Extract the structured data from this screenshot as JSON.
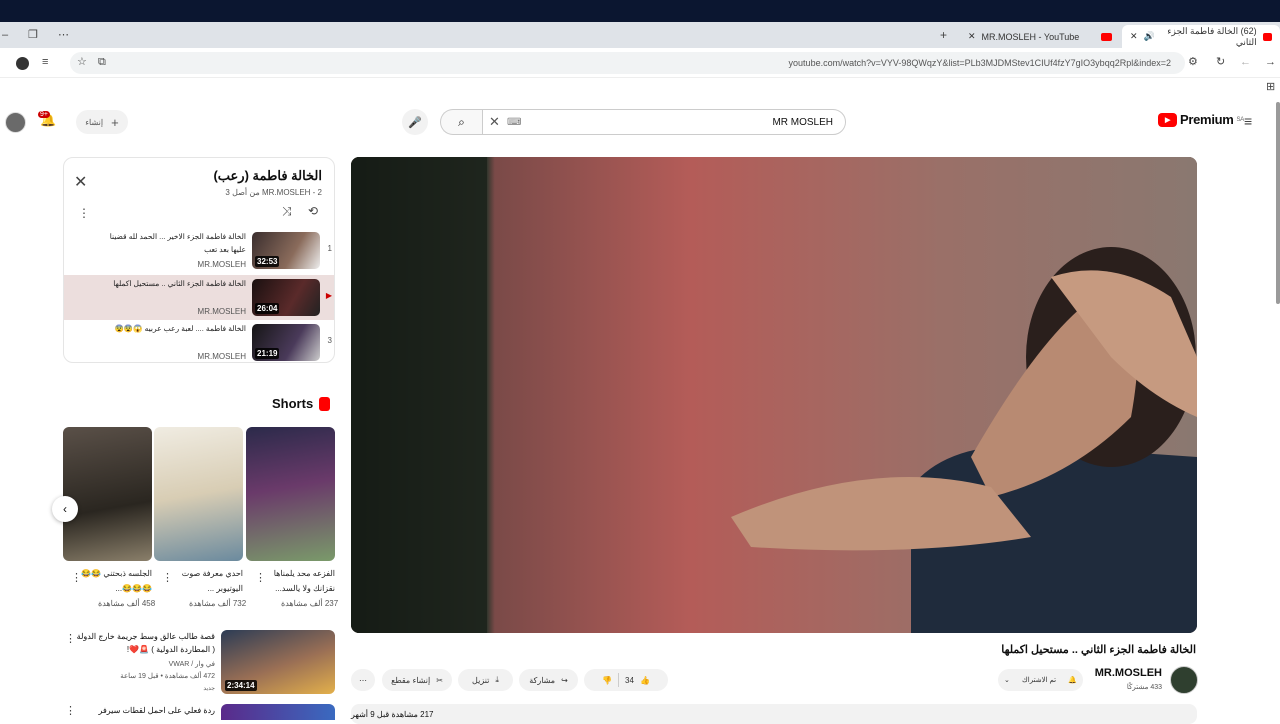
{
  "browser": {
    "tabs": [
      {
        "title": "(62) الخالة فاطمة الجزء الثاني",
        "active": true
      },
      {
        "title": "MR.MOSLEH - YouTube",
        "active": false
      }
    ],
    "url": "youtube.com/watch?v=VYV-98QWqzY&list=PLb3MJDMStev1CIUf4fzY7gIO3ybqq2Rpl&index=2"
  },
  "header": {
    "search_value": "MR MOSLEH",
    "create_label": "إنشاء",
    "notification_count": "9+",
    "logo_text": "Premium",
    "logo_region": "SA"
  },
  "playlist": {
    "title": "الخالة فاطمة (رعب)",
    "subtitle": "MR.MOSLEH - 2 من أصل 3",
    "items": [
      {
        "num": "1",
        "title": "الخالة فاطمة الجزء الاخير ... الحمد لله قضينا عليها بعد تعب",
        "channel": "MR.MOSLEH",
        "duration": "32:53"
      },
      {
        "num": "▶",
        "title": "الخالة فاطمة الجزء الثاني .. مستحيل اكملها",
        "channel": "MR.MOSLEH",
        "duration": "26:04"
      },
      {
        "num": "3",
        "title": "الخالة فاطمة .... لعبة رعب عربيه 😱😨😨",
        "channel": "MR.MOSLEH",
        "duration": "21:19"
      }
    ]
  },
  "shorts": {
    "heading": "Shorts",
    "items": [
      {
        "title": "الجلسه ذبحتني 😂😂😂😂😂...",
        "views": "458 ألف مشاهدة",
        "colors": [
          "#3a342d",
          "#8a7f6a"
        ]
      },
      {
        "title": "احدي معرفة صوت اليوتيوبر ...",
        "views": "732 ألف مشاهدة",
        "colors": [
          "#e9e4d6",
          "#6b8a9e"
        ]
      },
      {
        "title": "الفزعه محد يلمناها نقزانك ولا يالسد...",
        "views": "237 ألف مشاهدة",
        "colors": [
          "#2b2a4a",
          "#7a9a6a"
        ]
      }
    ]
  },
  "recommended": [
    {
      "title": "قصة طالب عالق وسط جريمة خارج الدولة ( المطاردة الدولية ) 🚨❤️!",
      "channel": "في وار / VWAR",
      "meta": "472 ألف مشاهدة • قبل 19 ساعة",
      "badge": "جديد",
      "duration": "2:34:14"
    },
    {
      "title": "ردة فعلي على احمل لقطات سيرفر ميستري",
      "channel": "",
      "meta": "",
      "badge": "",
      "duration": ""
    }
  ],
  "video": {
    "title": "الخالة فاطمة الجزء الثاني .. مستحيل اكملها",
    "channel": "MR.MOSLEH",
    "subscribers": "433 مشتركًا",
    "subscribed_label": "تم الاشتراك",
    "likes": "34",
    "share_label": "مشاركة",
    "download_label": "تنزيل",
    "clip_label": "إنشاء مقطع",
    "description_meta": "217 مشاهدة قبل 9 أشهر"
  },
  "colors": {
    "accent": "#ff0000",
    "current_item_bg": "#ecdedd"
  }
}
